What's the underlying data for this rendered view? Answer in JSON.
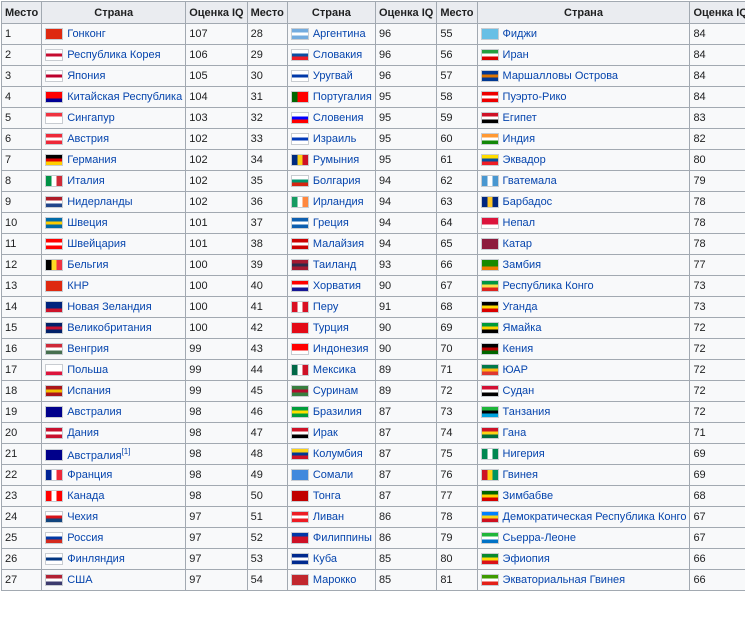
{
  "headers": {
    "rank": "Место",
    "country": "Страна",
    "iq": "Оценка IQ"
  },
  "columns": [
    [
      {
        "rank": "1",
        "country": "Гонконг",
        "iq": "107",
        "flag": [
          "#de2910",
          "#de2910",
          "#de2910"
        ]
      },
      {
        "rank": "2",
        "country": "Республика Корея",
        "iq": "106",
        "flag": [
          "#ffffff",
          "#c60c30",
          "#ffffff"
        ]
      },
      {
        "rank": "3",
        "country": "Япония",
        "iq": "105",
        "flag": [
          "#ffffff",
          "#bc002d",
          "#ffffff"
        ]
      },
      {
        "rank": "4",
        "country": "Китайская Республика",
        "iq": "104",
        "flag": [
          "#fe0000",
          "#fe0000",
          "#000095"
        ]
      },
      {
        "rank": "5",
        "country": "Сингапур",
        "iq": "103",
        "flag": [
          "#ef3340",
          "#ffffff",
          "#ffffff"
        ]
      },
      {
        "rank": "6",
        "country": "Австрия",
        "iq": "102",
        "flag": [
          "#ed2939",
          "#ffffff",
          "#ed2939"
        ]
      },
      {
        "rank": "7",
        "country": "Германия",
        "iq": "102",
        "flag": [
          "#000000",
          "#dd0000",
          "#ffce00"
        ]
      },
      {
        "rank": "8",
        "country": "Италия",
        "iq": "102",
        "flag": [
          "#009246",
          "#ffffff",
          "#ce2b37"
        ],
        "v": true
      },
      {
        "rank": "9",
        "country": "Нидерланды",
        "iq": "102",
        "flag": [
          "#ae1c28",
          "#ffffff",
          "#21468b"
        ]
      },
      {
        "rank": "10",
        "country": "Швеция",
        "iq": "101",
        "flag": [
          "#006aa7",
          "#fecc00",
          "#006aa7"
        ]
      },
      {
        "rank": "11",
        "country": "Швейцария",
        "iq": "101",
        "flag": [
          "#ff0000",
          "#ffffff",
          "#ff0000"
        ]
      },
      {
        "rank": "12",
        "country": "Бельгия",
        "iq": "100",
        "flag": [
          "#000000",
          "#fdda24",
          "#ef3340"
        ],
        "v": true
      },
      {
        "rank": "13",
        "country": "КНР",
        "iq": "100",
        "flag": [
          "#de2910",
          "#de2910",
          "#de2910"
        ]
      },
      {
        "rank": "14",
        "country": "Новая Зеландия",
        "iq": "100",
        "flag": [
          "#00247d",
          "#00247d",
          "#cc142b"
        ]
      },
      {
        "rank": "15",
        "country": "Великобритания",
        "iq": "100",
        "flag": [
          "#012169",
          "#c8102e",
          "#012169"
        ]
      },
      {
        "rank": "16",
        "country": "Венгрия",
        "iq": "99",
        "flag": [
          "#ce2939",
          "#ffffff",
          "#477050"
        ]
      },
      {
        "rank": "17",
        "country": "Польша",
        "iq": "99",
        "flag": [
          "#ffffff",
          "#ffffff",
          "#dc143c"
        ]
      },
      {
        "rank": "18",
        "country": "Испания",
        "iq": "99",
        "flag": [
          "#aa151b",
          "#f1bf00",
          "#aa151b"
        ]
      },
      {
        "rank": "19",
        "country": "Австралия",
        "iq": "98",
        "flag": [
          "#00008b",
          "#00008b",
          "#00008b"
        ]
      },
      {
        "rank": "20",
        "country": "Дания",
        "iq": "98",
        "flag": [
          "#c8102e",
          "#ffffff",
          "#c8102e"
        ]
      },
      {
        "rank": "21",
        "country": "Австралия",
        "iq": "98",
        "flag": [
          "#00008b",
          "#00008b",
          "#00008b"
        ],
        "note": "[1]"
      },
      {
        "rank": "22",
        "country": "Франция",
        "iq": "98",
        "flag": [
          "#002395",
          "#ffffff",
          "#ed2939"
        ],
        "v": true
      },
      {
        "rank": "23",
        "country": "Канада",
        "iq": "98",
        "flag": [
          "#ff0000",
          "#ffffff",
          "#ff0000"
        ],
        "v": true
      },
      {
        "rank": "24",
        "country": "Чехия",
        "iq": "97",
        "flag": [
          "#ffffff",
          "#d7141a",
          "#11457e"
        ]
      },
      {
        "rank": "25",
        "country": "Россия",
        "iq": "97",
        "flag": [
          "#ffffff",
          "#0039a6",
          "#d52b1e"
        ]
      },
      {
        "rank": "26",
        "country": "Финляндия",
        "iq": "97",
        "flag": [
          "#ffffff",
          "#003580",
          "#ffffff"
        ]
      },
      {
        "rank": "27",
        "country": "США",
        "iq": "97",
        "flag": [
          "#b22234",
          "#ffffff",
          "#3c3b6e"
        ]
      }
    ],
    [
      {
        "rank": "28",
        "country": "Аргентина",
        "iq": "96",
        "flag": [
          "#74acdf",
          "#ffffff",
          "#74acdf"
        ]
      },
      {
        "rank": "29",
        "country": "Словакия",
        "iq": "96",
        "flag": [
          "#ffffff",
          "#0b4ea2",
          "#ee1c25"
        ]
      },
      {
        "rank": "30",
        "country": "Уругвай",
        "iq": "96",
        "flag": [
          "#ffffff",
          "#0038a8",
          "#ffffff"
        ]
      },
      {
        "rank": "31",
        "country": "Португалия",
        "iq": "95",
        "flag": [
          "#006600",
          "#ff0000",
          "#ff0000"
        ],
        "v": true
      },
      {
        "rank": "32",
        "country": "Словения",
        "iq": "95",
        "flag": [
          "#ffffff",
          "#0000ff",
          "#ff0000"
        ]
      },
      {
        "rank": "33",
        "country": "Израиль",
        "iq": "95",
        "flag": [
          "#ffffff",
          "#0038b8",
          "#ffffff"
        ]
      },
      {
        "rank": "34",
        "country": "Румыния",
        "iq": "95",
        "flag": [
          "#002b7f",
          "#fcd116",
          "#ce1126"
        ],
        "v": true
      },
      {
        "rank": "35",
        "country": "Болгария",
        "iq": "94",
        "flag": [
          "#ffffff",
          "#00966e",
          "#d62612"
        ]
      },
      {
        "rank": "36",
        "country": "Ирландия",
        "iq": "94",
        "flag": [
          "#169b62",
          "#ffffff",
          "#ff883e"
        ],
        "v": true
      },
      {
        "rank": "37",
        "country": "Греция",
        "iq": "94",
        "flag": [
          "#0d5eaf",
          "#ffffff",
          "#0d5eaf"
        ]
      },
      {
        "rank": "38",
        "country": "Малайзия",
        "iq": "94",
        "flag": [
          "#cc0001",
          "#ffffff",
          "#cc0001"
        ]
      },
      {
        "rank": "39",
        "country": "Таиланд",
        "iq": "93",
        "flag": [
          "#a51931",
          "#2d2a4a",
          "#a51931"
        ]
      },
      {
        "rank": "40",
        "country": "Хорватия",
        "iq": "90",
        "flag": [
          "#ff0000",
          "#ffffff",
          "#171796"
        ]
      },
      {
        "rank": "41",
        "country": "Перу",
        "iq": "91",
        "flag": [
          "#d91023",
          "#ffffff",
          "#d91023"
        ],
        "v": true
      },
      {
        "rank": "42",
        "country": "Турция",
        "iq": "90",
        "flag": [
          "#e30a17",
          "#e30a17",
          "#e30a17"
        ]
      },
      {
        "rank": "43",
        "country": "Индонезия",
        "iq": "90",
        "flag": [
          "#ff0000",
          "#ff0000",
          "#ffffff"
        ]
      },
      {
        "rank": "44",
        "country": "Мексика",
        "iq": "89",
        "flag": [
          "#006847",
          "#ffffff",
          "#ce1126"
        ],
        "v": true
      },
      {
        "rank": "45",
        "country": "Суринам",
        "iq": "89",
        "flag": [
          "#377e3f",
          "#b40a2d",
          "#377e3f"
        ]
      },
      {
        "rank": "46",
        "country": "Бразилия",
        "iq": "87",
        "flag": [
          "#009c3b",
          "#ffdf00",
          "#009c3b"
        ]
      },
      {
        "rank": "47",
        "country": "Ирак",
        "iq": "87",
        "flag": [
          "#ce1126",
          "#ffffff",
          "#000000"
        ]
      },
      {
        "rank": "48",
        "country": "Колумбия",
        "iq": "87",
        "flag": [
          "#fcd116",
          "#003893",
          "#ce1126"
        ]
      },
      {
        "rank": "49",
        "country": "Сомали",
        "iq": "87",
        "flag": [
          "#4189dd",
          "#4189dd",
          "#4189dd"
        ]
      },
      {
        "rank": "50",
        "country": "Тонга",
        "iq": "87",
        "flag": [
          "#c10000",
          "#c10000",
          "#c10000"
        ]
      },
      {
        "rank": "51",
        "country": "Ливан",
        "iq": "86",
        "flag": [
          "#ed1c24",
          "#ffffff",
          "#ed1c24"
        ]
      },
      {
        "rank": "52",
        "country": "Филиппины",
        "iq": "86",
        "flag": [
          "#0038a8",
          "#ce1126",
          "#ce1126"
        ]
      },
      {
        "rank": "53",
        "country": "Куба",
        "iq": "85",
        "flag": [
          "#002a8f",
          "#ffffff",
          "#002a8f"
        ]
      },
      {
        "rank": "54",
        "country": "Марокко",
        "iq": "85",
        "flag": [
          "#c1272d",
          "#c1272d",
          "#c1272d"
        ]
      }
    ],
    [
      {
        "rank": "55",
        "country": "Фиджи",
        "iq": "84",
        "flag": [
          "#68bfe5",
          "#68bfe5",
          "#68bfe5"
        ]
      },
      {
        "rank": "56",
        "country": "Иран",
        "iq": "84",
        "flag": [
          "#239f40",
          "#ffffff",
          "#da0000"
        ]
      },
      {
        "rank": "57",
        "country": "Маршалловы Острова",
        "iq": "84",
        "flag": [
          "#003893",
          "#dd7500",
          "#003893"
        ]
      },
      {
        "rank": "58",
        "country": "Пуэрто-Рико",
        "iq": "84",
        "flag": [
          "#ed0000",
          "#ffffff",
          "#ed0000"
        ]
      },
      {
        "rank": "59",
        "country": "Египет",
        "iq": "83",
        "flag": [
          "#ce1126",
          "#ffffff",
          "#000000"
        ]
      },
      {
        "rank": "60",
        "country": "Индия",
        "iq": "82",
        "flag": [
          "#ff9933",
          "#ffffff",
          "#138808"
        ]
      },
      {
        "rank": "61",
        "country": "Эквадор",
        "iq": "80",
        "flag": [
          "#ffdd00",
          "#034ea2",
          "#ed1c24"
        ]
      },
      {
        "rank": "62",
        "country": "Гватемала",
        "iq": "79",
        "flag": [
          "#4997d0",
          "#ffffff",
          "#4997d0"
        ],
        "v": true
      },
      {
        "rank": "63",
        "country": "Барбадос",
        "iq": "78",
        "flag": [
          "#00267f",
          "#ffc726",
          "#00267f"
        ],
        "v": true
      },
      {
        "rank": "64",
        "country": "Непал",
        "iq": "78",
        "flag": [
          "#dc143c",
          "#dc143c",
          "#ffffff"
        ]
      },
      {
        "rank": "65",
        "country": "Катар",
        "iq": "78",
        "flag": [
          "#8d1b3d",
          "#8d1b3d",
          "#8d1b3d"
        ]
      },
      {
        "rank": "66",
        "country": "Замбия",
        "iq": "77",
        "flag": [
          "#198a00",
          "#198a00",
          "#ef7d00"
        ]
      },
      {
        "rank": "67",
        "country": "Республика Конго",
        "iq": "73",
        "flag": [
          "#009543",
          "#fbde4a",
          "#dc241f"
        ]
      },
      {
        "rank": "68",
        "country": "Уганда",
        "iq": "73",
        "flag": [
          "#000000",
          "#fcdc04",
          "#d90000"
        ]
      },
      {
        "rank": "69",
        "country": "Ямайка",
        "iq": "72",
        "flag": [
          "#009b3a",
          "#fed100",
          "#000000"
        ]
      },
      {
        "rank": "70",
        "country": "Кения",
        "iq": "72",
        "flag": [
          "#000000",
          "#bb0000",
          "#006600"
        ]
      },
      {
        "rank": "71",
        "country": "ЮАР",
        "iq": "72",
        "flag": [
          "#007a4d",
          "#ffb612",
          "#de3831"
        ]
      },
      {
        "rank": "72",
        "country": "Судан",
        "iq": "72",
        "flag": [
          "#d21034",
          "#ffffff",
          "#000000"
        ]
      },
      {
        "rank": "73",
        "country": "Танзания",
        "iq": "72",
        "flag": [
          "#1eb53a",
          "#000000",
          "#00a3dd"
        ]
      },
      {
        "rank": "74",
        "country": "Гана",
        "iq": "71",
        "flag": [
          "#ce1126",
          "#fcd116",
          "#006b3f"
        ]
      },
      {
        "rank": "75",
        "country": "Нигерия",
        "iq": "69",
        "flag": [
          "#008751",
          "#ffffff",
          "#008751"
        ],
        "v": true
      },
      {
        "rank": "76",
        "country": "Гвинея",
        "iq": "69",
        "flag": [
          "#ce1126",
          "#fcd116",
          "#009460"
        ],
        "v": true
      },
      {
        "rank": "77",
        "country": "Зимбабве",
        "iq": "68",
        "flag": [
          "#006400",
          "#ffd200",
          "#d40000"
        ]
      },
      {
        "rank": "78",
        "country": "Демократическая Республика Конго",
        "iq": "67",
        "flag": [
          "#007fff",
          "#f7d618",
          "#ce1021"
        ]
      },
      {
        "rank": "79",
        "country": "Сьерра-Леоне",
        "iq": "67",
        "flag": [
          "#1eb53a",
          "#ffffff",
          "#0072c6"
        ]
      },
      {
        "rank": "80",
        "country": "Эфиопия",
        "iq": "66",
        "flag": [
          "#078930",
          "#fcdd09",
          "#da121a"
        ]
      },
      {
        "rank": "81",
        "country": "Экваториальная Гвинея",
        "iq": "66",
        "flag": [
          "#3e9a00",
          "#ffffff",
          "#e32118"
        ]
      }
    ]
  ]
}
